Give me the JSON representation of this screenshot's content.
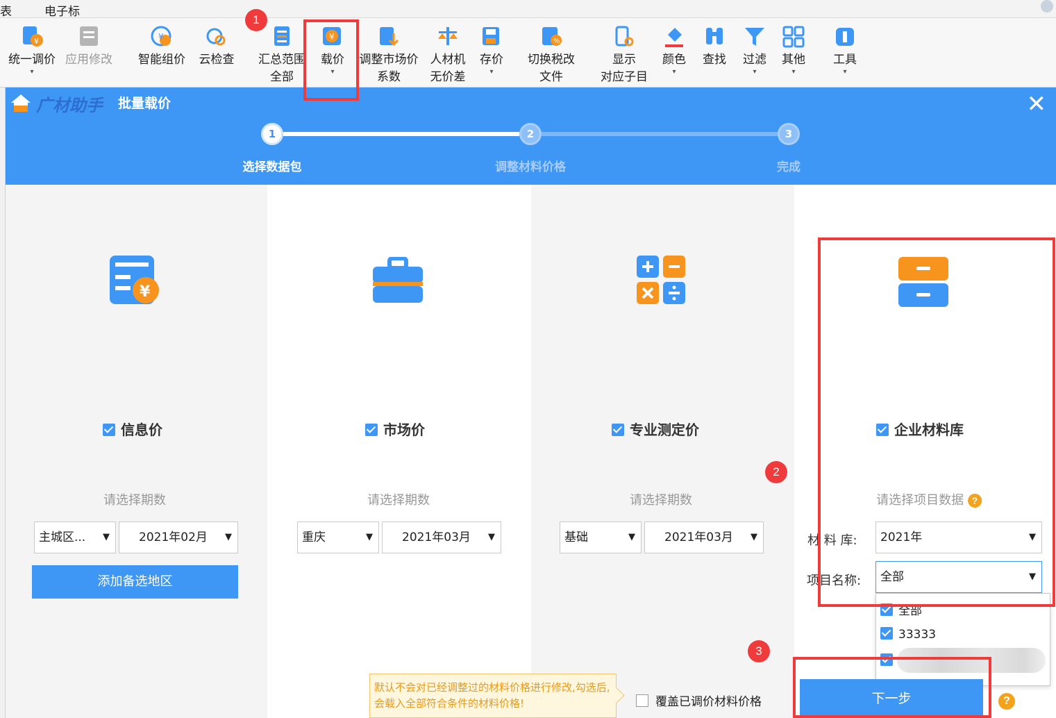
{
  "menubar": {
    "item1": "表",
    "item2": "电子标"
  },
  "ribbon": {
    "tools": [
      {
        "label": "统一调价",
        "sub": "▾"
      },
      {
        "label": "应用修改",
        "sub": ""
      },
      {
        "label": "智能组价",
        "sub": ""
      },
      {
        "label": "云检查",
        "sub": ""
      },
      {
        "label": "汇总范围",
        "sub": "全部"
      },
      {
        "label": "载价",
        "sub": "▾"
      },
      {
        "label": "调整市场价",
        "sub": "系数"
      },
      {
        "label": "人材机",
        "sub": "无价差"
      },
      {
        "label": "存价",
        "sub": "▾"
      },
      {
        "label": "切换税改",
        "sub": "文件"
      },
      {
        "label": "显示",
        "sub": "对应子目"
      },
      {
        "label": "颜色",
        "sub": "▾"
      },
      {
        "label": "查找",
        "sub": ""
      },
      {
        "label": "过滤",
        "sub": "▾"
      },
      {
        "label": "其他",
        "sub": "▾"
      },
      {
        "label": "工具",
        "sub": "▾"
      }
    ]
  },
  "badges": {
    "b1": "1",
    "b2": "2",
    "b3": "3"
  },
  "dialog": {
    "brand": "广材助手",
    "title": "批量载价",
    "close": "✕",
    "steps": [
      {
        "num": "1",
        "label": "选择数据包"
      },
      {
        "num": "2",
        "label": "调整材料价格"
      },
      {
        "num": "3",
        "label": "完成"
      }
    ]
  },
  "columns": {
    "info": {
      "title": "信息价",
      "sublabel": "请选择期数",
      "select1": "主城区...",
      "select2": "2021年02月",
      "button": "添加备选地区"
    },
    "market": {
      "title": "市场价",
      "sublabel": "请选择期数",
      "select1": "重庆",
      "select2": "2021年03月"
    },
    "pro": {
      "title": "专业测定价",
      "sublabel": "请选择期数",
      "select1": "基础",
      "select2": "2021年03月"
    },
    "enterprise": {
      "title": "企业材料库",
      "sublabel": "请选择项目数据",
      "help": "?",
      "lib_label": "材 料 库:",
      "lib_value": "2021年",
      "proj_label": "项目名称:",
      "proj_value": "全部",
      "options": [
        "全部",
        "33333"
      ]
    }
  },
  "footer": {
    "tip": "默认不会对已经调整过的材料价格进行修改,勾选后,会载入全部符合条件的材料价格!",
    "cover_label": "覆盖已调价材料价格",
    "next": "下一步",
    "help": "?"
  },
  "colors": {
    "accent": "#3e97f4",
    "highlight": "#ee3b3b",
    "warning": "#f2a21b",
    "orange": "#f7941d"
  }
}
